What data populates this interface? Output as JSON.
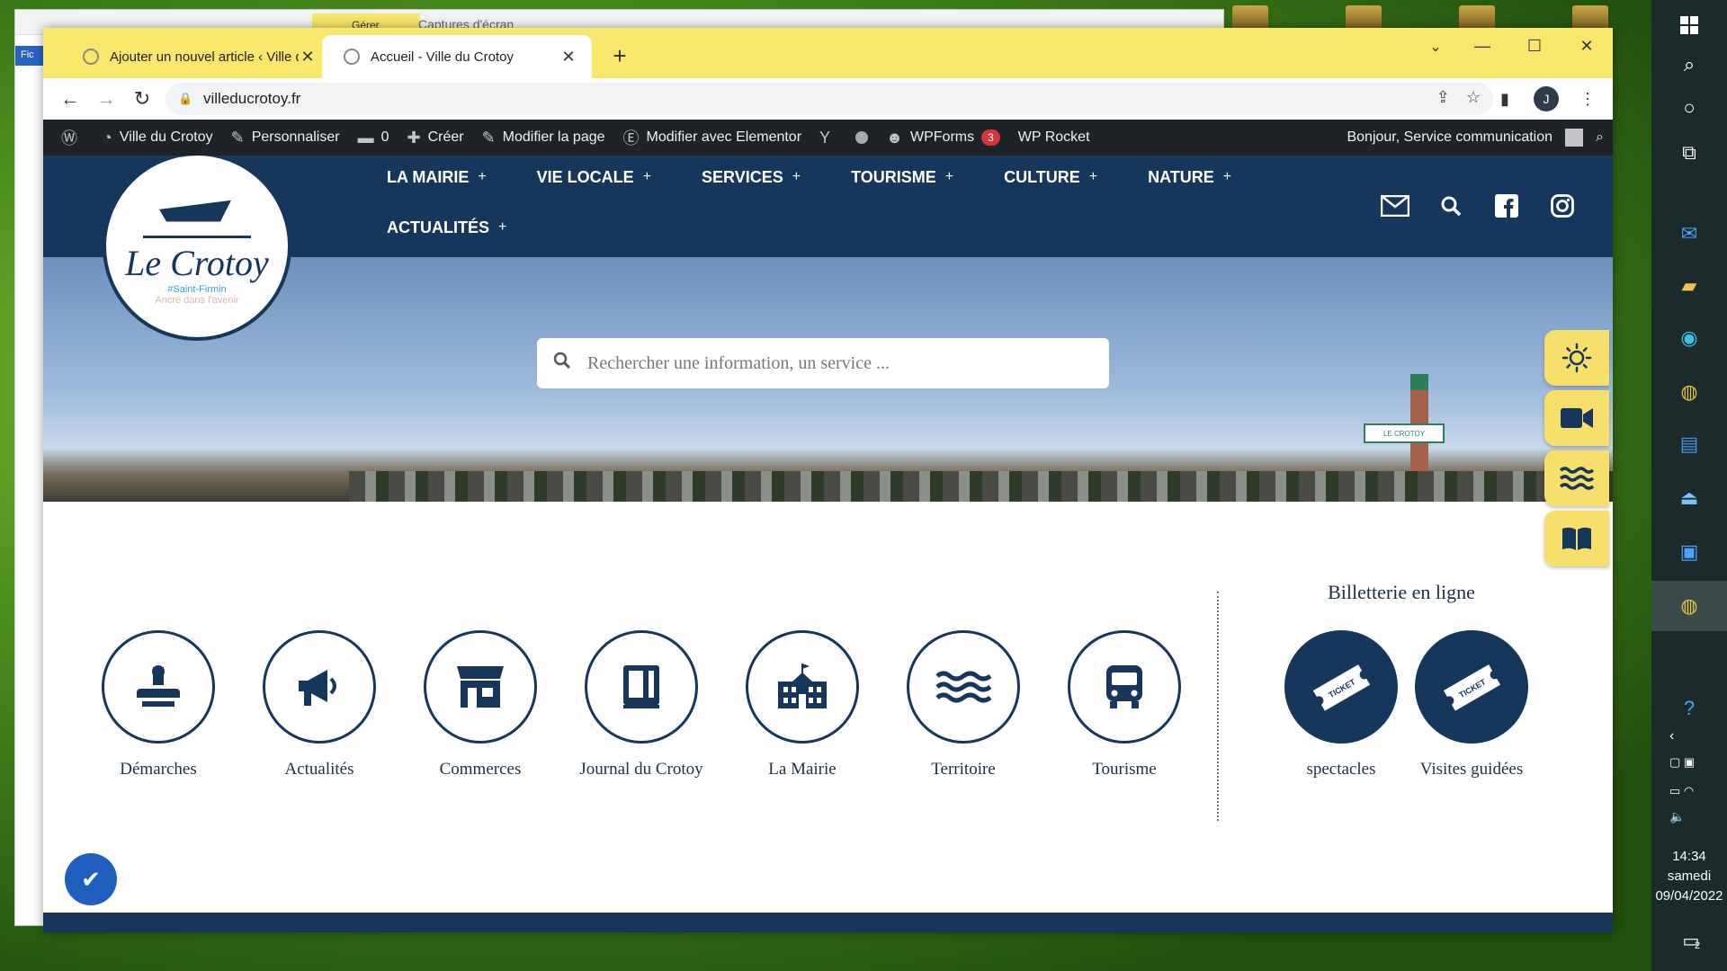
{
  "browser": {
    "tabs": [
      {
        "title": "Ajouter un nouvel article ‹ Ville d",
        "close": "✕"
      },
      {
        "title": "Accueil - Ville du Crotoy",
        "close": "✕"
      }
    ],
    "new_tab": "+",
    "url": "villeducrotoy.fr",
    "profile_initial": "J"
  },
  "background_window": {
    "tab_label": "Gérer",
    "title": "Captures d'écran",
    "side_label": "Fic"
  },
  "wp_admin_bar": {
    "site_name": "Ville du Crotoy",
    "customize": "Personnaliser",
    "comments_count": "0",
    "new": "Créer",
    "edit_page": "Modifier la page",
    "edit_elementor": "Modifier avec Elementor",
    "wpforms": "WPForms",
    "wpforms_badge": "3",
    "wp_rocket": "WP Rocket",
    "greeting": "Bonjour, Service communication"
  },
  "site": {
    "logo": {
      "text": "Le Crotoy",
      "subtitle": "#Saint-Firmin",
      "tagline": "Ancré dans l'avenir"
    },
    "nav": [
      {
        "label": "LA MAIRIE"
      },
      {
        "label": "VIE LOCALE"
      },
      {
        "label": "SERVICES"
      },
      {
        "label": "TOURISME"
      },
      {
        "label": "CULTURE"
      },
      {
        "label": "NATURE"
      },
      {
        "label": "ACTUALITÉS"
      }
    ],
    "nav_plus": "+",
    "search_placeholder": "Rechercher une information, un service ...",
    "hero_sign": "LE CROTOY",
    "services": [
      {
        "label": "Démarches",
        "icon": "stamp-icon"
      },
      {
        "label": "Actualités",
        "icon": "megaphone-icon"
      },
      {
        "label": "Commerces",
        "icon": "shop-icon"
      },
      {
        "label": "Journal du Crotoy",
        "icon": "book-icon"
      },
      {
        "label": "La Mairie",
        "icon": "town-hall-icon"
      },
      {
        "label": "Territoire",
        "icon": "waves-icon"
      },
      {
        "label": "Tourisme",
        "icon": "bus-icon"
      }
    ],
    "billetterie": {
      "title": "Billetterie en ligne",
      "items": [
        {
          "label": "spectacles",
          "icon": "ticket-icon"
        },
        {
          "label": "Visites guidées",
          "icon": "ticket-icon"
        }
      ]
    }
  },
  "taskbar": {
    "time": "14:34",
    "day": "samedi",
    "date": "09/04/2022",
    "notifications": "2"
  },
  "colors": {
    "brand_navy": "#17365b",
    "tab_yellow": "#f7e76a",
    "side_tool_yellow": "#f6e06b",
    "wp_bar": "#1d2327"
  }
}
